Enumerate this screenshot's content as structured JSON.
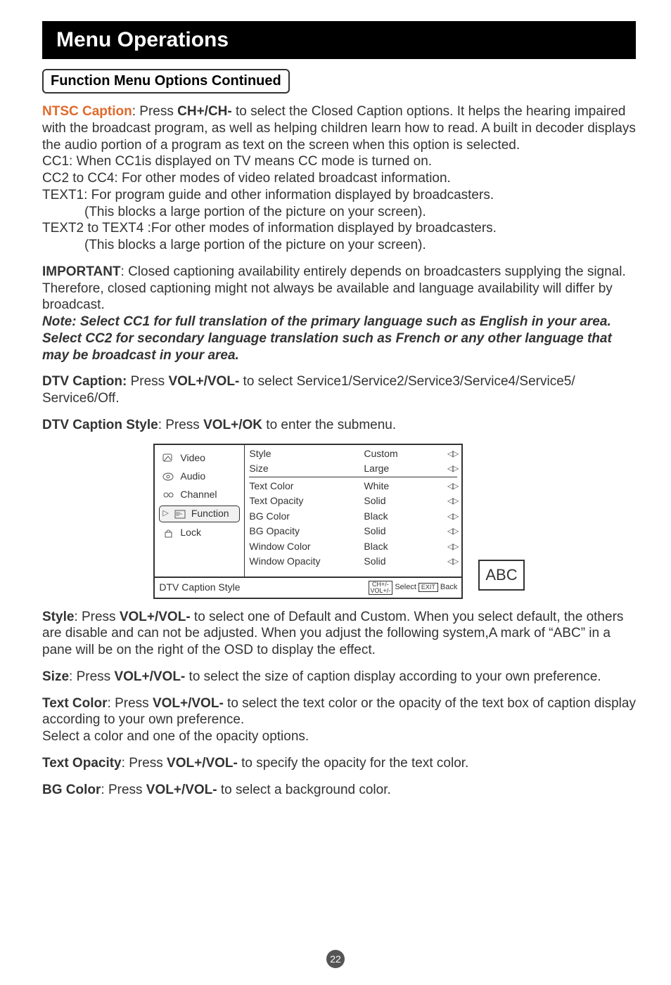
{
  "title_bar": "Menu Operations",
  "subtitle": "Function Menu Options Continued",
  "ntsc": {
    "label": "NTSC Caption",
    "text1": ": Press ",
    "key1": "CH+/CH-",
    "text2": " to select the Closed Caption options.  It helps the hearing impaired with the broadcast program, as well as helping children learn how to read.  A built in decoder displays the audio portion of a program as text on the screen when this  option is selected.",
    "cc1": "CC1:  When CC1is displayed on TV means CC mode is turned on.",
    "cc2": "CC2 to CC4: For other modes of video related broadcast information.",
    "text1a": "TEXT1: For program guide and other information displayed by broadcasters.",
    "text1b": "(This blocks a large portion of the picture on your screen).",
    "text2a": "TEXT2 to TEXT4 :For other modes of information displayed by broadcasters.",
    "text2b": "(This blocks a large portion of the picture on your screen)."
  },
  "important": {
    "label": "IMPORTANT",
    "text": ": Closed captioning availability entirely depends on broadcasters supplying the signal. Therefore, closed captioning might not always be available and language availability will differ by broadcast.",
    "note": "Note: Select CC1 for full translation of the primary language such as English in your area. Select CC2 for secondary language translation such as French  or any other language that may be broadcast in your area."
  },
  "dtv_caption": {
    "label": "DTV Caption:",
    "pre": " Press ",
    "key": "VOL+/VOL-",
    "post": " to select Service1/Service2/Service3/Service4/Service5/",
    "post2": "Service6/Off."
  },
  "dtv_style": {
    "label": "DTV Caption Style",
    "pre": ": Press ",
    "key": "VOL+/OK",
    "post": " to enter the submenu."
  },
  "chart_data": {
    "type": "table",
    "tabs": [
      "Video",
      "Audio",
      "Channel",
      "Function",
      "Lock"
    ],
    "active_tab": "Function",
    "rows": [
      {
        "key": "Style",
        "value": "Custom"
      },
      {
        "key": "Size",
        "value": "Large"
      },
      {
        "key": "Text Color",
        "value": "White"
      },
      {
        "key": "Text Opacity",
        "value": "Solid"
      },
      {
        "key": "BG Color",
        "value": "Black"
      },
      {
        "key": "BG Opacity",
        "value": "Solid"
      },
      {
        "key": "Window Color",
        "value": "Black"
      },
      {
        "key": "Window Opacity",
        "value": "Solid"
      }
    ],
    "footer_title": "DTV Caption Style",
    "footer_key1a": "CH+/-",
    "footer_key1b": "VOL+/-",
    "footer_lbl1": "Select",
    "footer_key2": "EXIT",
    "footer_lbl2": "Back",
    "preview": "ABC"
  },
  "style_para": {
    "label": "Style",
    "pre": ": Press ",
    "key": "VOL+/VOL-",
    "post": " to select one of Default and Custom. When you select default, the others are disable and can not be adjusted. When you adjust the following system,A mark of   “ABC”  in a pane will be on the right of the OSD to display the effect."
  },
  "size_para": {
    "label": "Size",
    "pre": ": Press ",
    "key": "VOL+/VOL-",
    "post": " to select the size of caption display according to your own preference."
  },
  "textcolor_para": {
    "label": "Text Color",
    "pre": ": Press ",
    "key": "VOL+/VOL-",
    "post": " to select the text color or the opacity of the text box of caption display according to your own preference.",
    "post2": "Select a color and one of the opacity options."
  },
  "textopacity_para": {
    "label": "Text Opacity",
    "pre": ": Press ",
    "key": "VOL+/VOL-",
    "post": " to specify the opacity for the text color."
  },
  "bgcolor_para": {
    "label": "BG Color",
    "pre": ": Press ",
    "key": "VOL+/VOL-",
    "post": " to select a background color."
  },
  "page_number": "22"
}
